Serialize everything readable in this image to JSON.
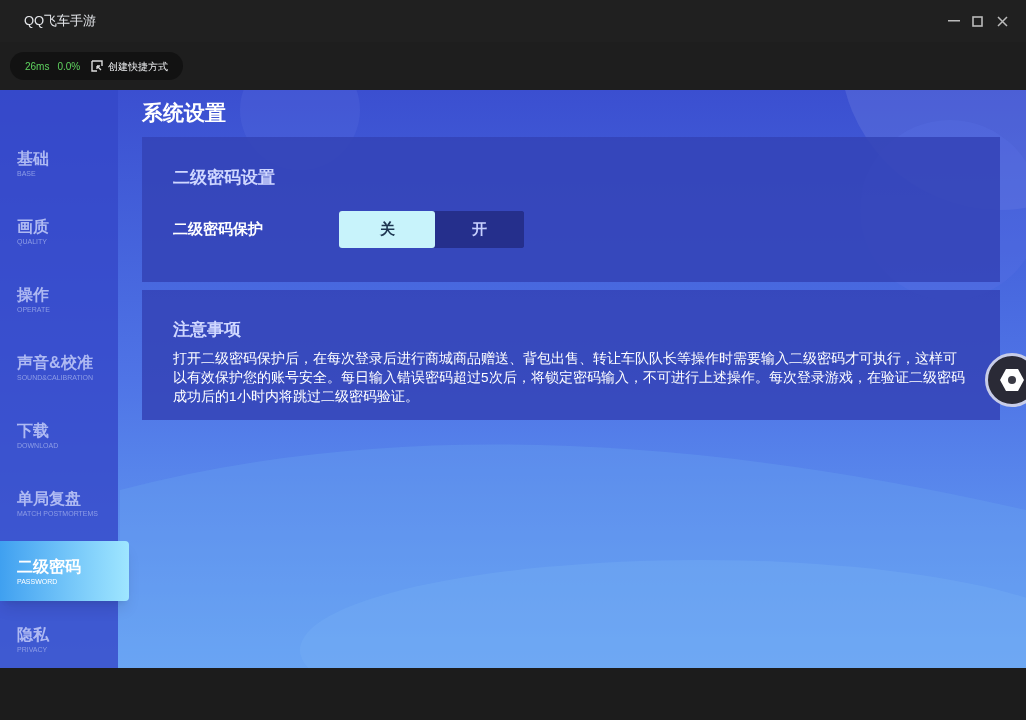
{
  "window": {
    "title": "QQ飞车手游"
  },
  "toolbar": {
    "latency": "26ms",
    "loss": "0.0%",
    "shortcut_label": "创建快捷方式"
  },
  "sidebar": {
    "items": [
      {
        "label": "基础",
        "sublabel": "BASE",
        "selected": false
      },
      {
        "label": "画质",
        "sublabel": "QUALITY",
        "selected": false
      },
      {
        "label": "操作",
        "sublabel": "OPERATE",
        "selected": false
      },
      {
        "label": "声音&校准",
        "sublabel": "SOUND&CALIBRATION",
        "selected": false
      },
      {
        "label": "下载",
        "sublabel": "DOWNLOAD",
        "selected": false
      },
      {
        "label": "单局复盘",
        "sublabel": "MATCH POSTMORTEMS",
        "selected": false
      },
      {
        "label": "二级密码",
        "sublabel": "PASSWORD",
        "selected": true
      },
      {
        "label": "隐私",
        "sublabel": "PRIVACY",
        "selected": false
      }
    ]
  },
  "page_title": "系统设置",
  "password_panel": {
    "title": "二级密码设置",
    "setting_label": "二级密码保护",
    "options": [
      {
        "label": "关",
        "selected": true
      },
      {
        "label": "开",
        "selected": false
      }
    ]
  },
  "notice_panel": {
    "title": "注意事项",
    "body": "打开二级密码保护后，在每次登录后进行商城商品赠送、背包出售、转让车队队长等操作时需要输入二级密码才可执行，这样可以有效保护您的账号安全。每日输入错误密码超过5次后，将锁定密码输入，不可进行上述操作。每次登录游戏，在验证二级密码成功后的1小时内将跳过二级密码验证。"
  }
}
